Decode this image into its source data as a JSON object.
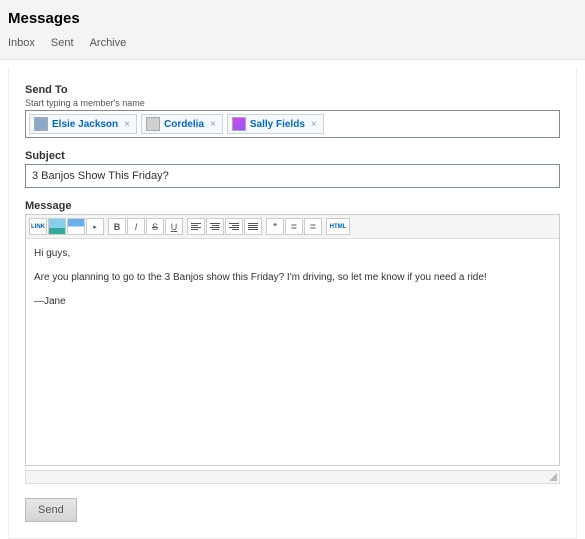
{
  "header": {
    "title": "Messages",
    "tabs": [
      "Inbox",
      "Sent",
      "Archive"
    ]
  },
  "form": {
    "sendto_label": "Send To",
    "sendto_hint": "Start typing a member's name",
    "recipients": [
      {
        "name": "Elsie Jackson"
      },
      {
        "name": "Cordelia"
      },
      {
        "name": "Sally Fields"
      }
    ],
    "subject_label": "Subject",
    "subject_value": "3 Banjos Show This Friday?",
    "message_label": "Message",
    "body_lines": [
      "Hi guys,",
      "Are you planning to go to the 3 Banjos show this Friday? I'm driving, so let me know if you need a ride!",
      "—Jane"
    ],
    "send_label": "Send"
  },
  "toolbar": {
    "link": "LINK",
    "b": "B",
    "i": "I",
    "s": "S",
    "u": "U",
    "quote": "❝",
    "ul": "≣",
    "ol": "≣",
    "html": "HTML"
  }
}
